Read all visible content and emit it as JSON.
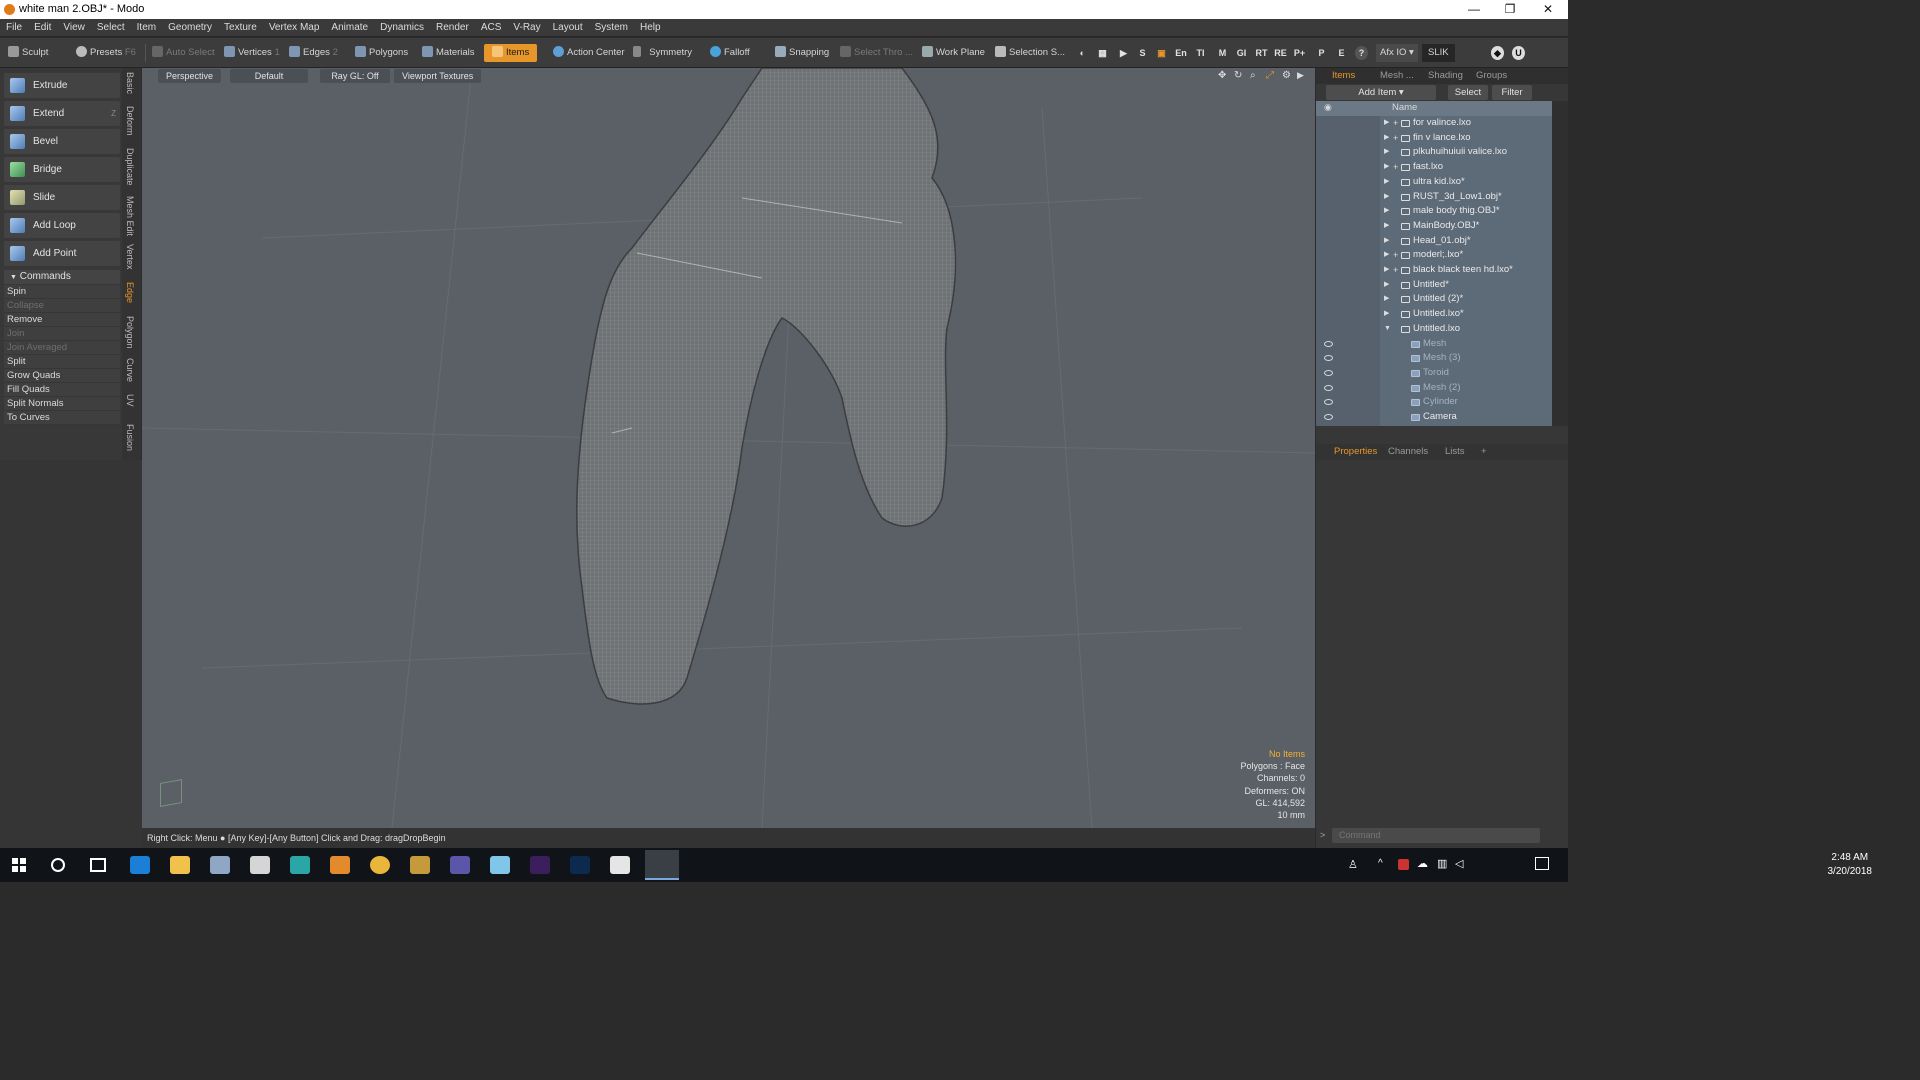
{
  "window": {
    "title": "white man 2.OBJ* - Modo",
    "minimize": "—",
    "maximize": "❐",
    "close": "✕"
  },
  "menu": [
    "File",
    "Edit",
    "View",
    "Select",
    "Item",
    "Geometry",
    "Texture",
    "Vertex Map",
    "Animate",
    "Dynamics",
    "Render",
    "ACS",
    "V-Ray",
    "Layout",
    "System",
    "Help"
  ],
  "toolbar": {
    "sculpt": "Sculpt",
    "presets": "Presets",
    "presets_key": "F6",
    "auto_select": "Auto Select",
    "vertices": "Vertices",
    "vertices_key": "1",
    "edges": "Edges",
    "edges_key": "2",
    "polygons": "Polygons",
    "materials": "Materials",
    "items": "Items",
    "action_center": "Action Center",
    "symmetry": "Symmetry",
    "falloff": "Falloff",
    "snapping": "Snapping",
    "select_thro": "Select Thro ...",
    "work_plane": "Work Plane",
    "selection_s": "Selection S...",
    "right_icons": [
      "S",
      "En",
      "TI",
      "M",
      "GI",
      "RT",
      "RE",
      "P+",
      "P",
      "E",
      "?"
    ],
    "afx_io": "Afx IO",
    "slik": "SLIK"
  },
  "tools": [
    {
      "label": "Extrude",
      "key": ""
    },
    {
      "label": "Extend",
      "key": "Z"
    },
    {
      "label": "Bevel",
      "key": ""
    },
    {
      "label": "Bridge",
      "key": ""
    },
    {
      "label": "Slide",
      "key": ""
    },
    {
      "label": "Add Loop",
      "key": ""
    },
    {
      "label": "Add Point",
      "key": ""
    }
  ],
  "commands_header": "Commands",
  "commands": [
    {
      "label": "Spin",
      "enabled": true
    },
    {
      "label": "Collapse",
      "enabled": false
    },
    {
      "label": "Remove",
      "enabled": true
    },
    {
      "label": "Join",
      "enabled": false
    },
    {
      "label": "Join Averaged",
      "enabled": false
    },
    {
      "label": "Split",
      "enabled": true
    },
    {
      "label": "Grow Quads",
      "enabled": true
    },
    {
      "label": "Fill Quads",
      "enabled": true
    },
    {
      "label": "Split Normals",
      "enabled": true
    },
    {
      "label": "To Curves",
      "enabled": true
    }
  ],
  "vertical_tabs": [
    "Basic",
    "Deform",
    "Duplicate",
    "Mesh Edit",
    "Vertex",
    "Edge",
    "Polygon",
    "Curve",
    "UV",
    "Fusion"
  ],
  "active_vertical_tab": "Edge",
  "viewport": {
    "perspective": "Perspective",
    "default": "Default",
    "ray_gl": "Ray GL: Off",
    "viewport_textures": "Viewport Textures",
    "stats": {
      "no_items": "No Items",
      "polygons": "Polygons : Face",
      "channels": "Channels: 0",
      "deformers": "Deformers: ON",
      "gl": "GL: 414,592",
      "scale": "10 mm"
    }
  },
  "status": "Right Click: Menu ● [Any Key]-[Any Button] Click and Drag: dragDropBegin",
  "right_panel": {
    "tabs": [
      "Items",
      "Mesh ...",
      "Shading",
      "Groups"
    ],
    "add_item": "Add Item",
    "select": "Select",
    "filter": "Filter",
    "name_header": "Name",
    "items": [
      {
        "name": "for valince.lxo",
        "plus": true,
        "sub": false
      },
      {
        "name": "fin v lance.lxo",
        "plus": true,
        "sub": false
      },
      {
        "name": "plkuhuihuiuii valice.lxo",
        "plus": false,
        "sub": false
      },
      {
        "name": "fast.lxo",
        "plus": true,
        "sub": false
      },
      {
        "name": "ultra kid.lxo*",
        "plus": false,
        "sub": false
      },
      {
        "name": "RUST_3d_Low1.obj*",
        "plus": false,
        "sub": false
      },
      {
        "name": "male body thig.OBJ*",
        "plus": false,
        "sub": false
      },
      {
        "name": "MainBody.OBJ*",
        "plus": false,
        "sub": false
      },
      {
        "name": "Head_01.obj*",
        "plus": false,
        "sub": false
      },
      {
        "name": "moderl;.lxo*",
        "plus": true,
        "sub": false
      },
      {
        "name": "black black teen hd.lxo*",
        "plus": true,
        "sub": false
      },
      {
        "name": "Untitled*",
        "plus": false,
        "sub": false
      },
      {
        "name": "Untitled (2)*",
        "plus": false,
        "sub": false
      },
      {
        "name": "Untitled.lxo*",
        "plus": false,
        "sub": false
      },
      {
        "name": "Untitled.lxo",
        "plus": false,
        "sub": false,
        "expanded": true
      },
      {
        "name": "Mesh",
        "sub": true
      },
      {
        "name": "Mesh (3)",
        "sub": true
      },
      {
        "name": "Toroid",
        "sub": true
      },
      {
        "name": "Mesh (2)",
        "sub": true
      },
      {
        "name": "Cylinder",
        "sub": true
      },
      {
        "name": "Camera",
        "sub": true,
        "camera": true
      }
    ],
    "prop_tabs": [
      "Properties",
      "Channels",
      "Lists",
      "+"
    ],
    "command_placeholder": "Command"
  },
  "taskbar": {
    "time": "2:48 AM",
    "date": "3/20/2018"
  },
  "colors": {
    "accent": "#e7962a",
    "viewport": "#5a6066",
    "panel": "#373737"
  }
}
